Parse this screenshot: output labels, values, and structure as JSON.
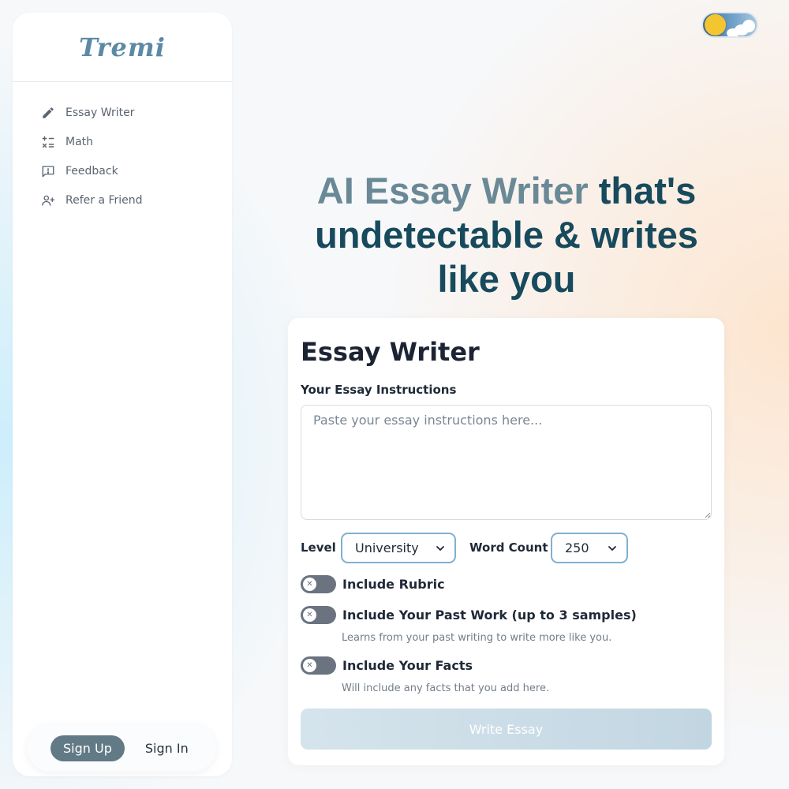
{
  "sidebar": {
    "logo": "Tremi",
    "items": [
      {
        "label": "Essay Writer",
        "icon": "pencil-icon"
      },
      {
        "label": "Math",
        "icon": "math-operators-icon"
      },
      {
        "label": "Feedback",
        "icon": "feedback-icon"
      },
      {
        "label": "Refer a Friend",
        "icon": "add-user-icon"
      }
    ],
    "signup_label": "Sign Up",
    "signin_label": "Sign In"
  },
  "hero": {
    "accent": "AI Essay Writer",
    "rest": " that's undetectable & writes like you"
  },
  "card": {
    "title": "Essay Writer",
    "instructions_label": "Your Essay Instructions",
    "instructions_placeholder": "Paste your essay instructions here...",
    "instructions_value": "",
    "level_label": "Level",
    "level_value": "University",
    "word_count_label": "Word Count",
    "word_count_value": "250",
    "toggles": [
      {
        "label": "Include Rubric",
        "sub": "",
        "on": false
      },
      {
        "label": "Include Your Past Work (up to 3 samples)",
        "sub": "Learns from your past writing to write more like you.",
        "on": false
      },
      {
        "label": "Include Your Facts",
        "sub": "Will include any facts that you add here.",
        "on": false
      }
    ],
    "submit_label": "Write Essay"
  },
  "colors": {
    "accent": "#6a8996",
    "heading": "#174a5c",
    "brand": "#5a8aa6",
    "select_border": "#7fb0cf",
    "signup_bg": "#627a86"
  },
  "theme_toggle": {
    "icon": "sun-cloud-icon",
    "mode": "light"
  }
}
